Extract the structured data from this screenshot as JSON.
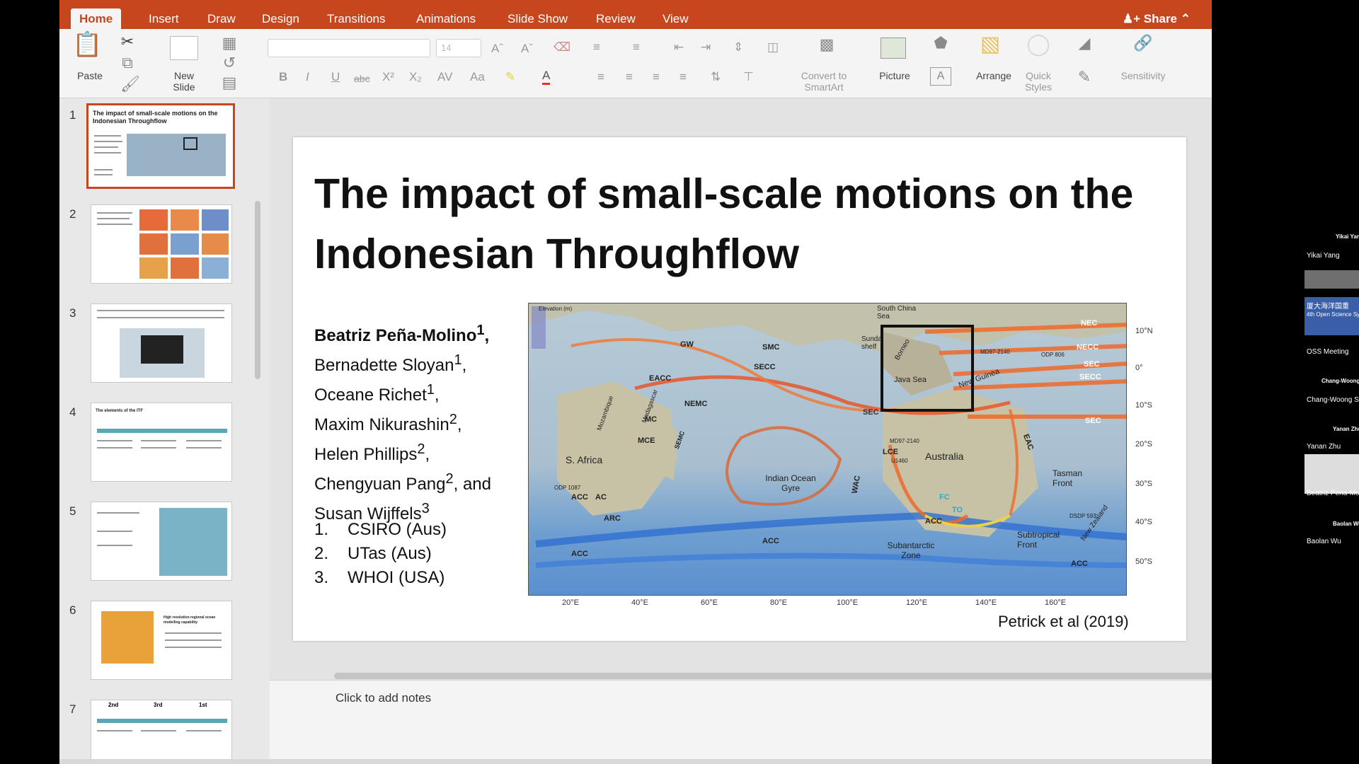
{
  "ribbon": {
    "tabs": [
      {
        "label": "Home",
        "active": true
      },
      {
        "label": "Insert"
      },
      {
        "label": "Draw"
      },
      {
        "label": "Design"
      },
      {
        "label": "Transitions"
      },
      {
        "label": "Animations"
      },
      {
        "label": "Slide Show"
      },
      {
        "label": "Review"
      },
      {
        "label": "View"
      }
    ],
    "share_label": "Share",
    "paste_label": "Paste",
    "new_slide_label": "New Slide",
    "font_size": "14",
    "convert_label": "Convert to SmartArt",
    "picture_label": "Picture",
    "arrange_label": "Arrange",
    "quick_styles_label": "Quick Styles",
    "sensitivity_label": "Sensitivity"
  },
  "thumbnails": [
    {
      "number": "1",
      "title": "The impact of small-scale motions on the Indonesian Throughflow"
    },
    {
      "number": "2"
    },
    {
      "number": "3"
    },
    {
      "number": "4",
      "title": "The elements of the ITF"
    },
    {
      "number": "5"
    },
    {
      "number": "6",
      "title": "High resolution regional ocean modelling capability"
    },
    {
      "number": "7",
      "cols": [
        "2nd",
        "3rd",
        "1st"
      ]
    }
  ],
  "slide": {
    "title": "The impact of small-scale motions on the Indonesian Throughflow",
    "authors": [
      {
        "name": "Beatriz Peña-Molino",
        "sup": "1"
      },
      {
        "name": "Bernadette Sloyan",
        "sup": "1"
      },
      {
        "name": "Oceane Richet",
        "sup": "1"
      },
      {
        "name": "Maxim Nikurashin",
        "sup": "2"
      },
      {
        "name": "Helen Phillips",
        "sup": "2"
      },
      {
        "name": "Chengyuan Pang",
        "sup": "2"
      },
      {
        "name": "Susan Wijffels",
        "sup": "3"
      }
    ],
    "authors_and": "and",
    "affiliations": [
      {
        "n": "1.",
        "name": "CSIRO (Aus)"
      },
      {
        "n": "2.",
        "name": "UTas (Aus)"
      },
      {
        "n": "3.",
        "name": "WHOI (USA)"
      }
    ],
    "credit": "Petrick et al (2019)",
    "map": {
      "lat_labels": [
        "10°N",
        "0°",
        "10°S",
        "20°S",
        "30°S",
        "40°S",
        "50°S"
      ],
      "lon_labels": [
        "20°E",
        "40°E",
        "60°E",
        "80°E",
        "100°E",
        "120°E",
        "140°E",
        "160°E"
      ],
      "places": [
        "South China Sea",
        "Australia",
        "S. Africa",
        "Indian Ocean Gyre",
        "Subantarctic Zone",
        "Tasman Front",
        "Subtropical Front",
        "New Zealand",
        "New Guinea",
        "Java Sea",
        "Borneo",
        "Sunda shelf",
        "Madagascar",
        "Mozambique"
      ],
      "currents": [
        "NEC",
        "NECC",
        "SEC",
        "SECC",
        "SEC",
        "SEC",
        "ACC",
        "ACC",
        "ACC",
        "ACC",
        "ACC",
        "EACC",
        "NEMC",
        "GW",
        "SMC",
        "SECC",
        "MC",
        "MCE",
        "LCE",
        "WAC",
        "EAC",
        "ARC",
        "AC",
        "TO",
        "FC",
        "SEMC"
      ],
      "sites": [
        "MD97-2140",
        "ODP 806",
        "MD97-2140",
        "U1460",
        "ODP 1087",
        "DSDP 593"
      ],
      "legend_title": "Elevation (m)"
    }
  },
  "notes_placeholder": "Click to add notes",
  "participants": [
    "Yikai Yang",
    "Yikai Yang",
    "厦大海洋国重",
    "4th Open Science Sy",
    "OSS Meeting",
    "Chang-Woong",
    "Chang-Woong Sh",
    "Yanan Zhu",
    "Yanan Zhu",
    "Beatriz Pena-Mol",
    "Baolan Wu",
    "Baolan Wu"
  ]
}
